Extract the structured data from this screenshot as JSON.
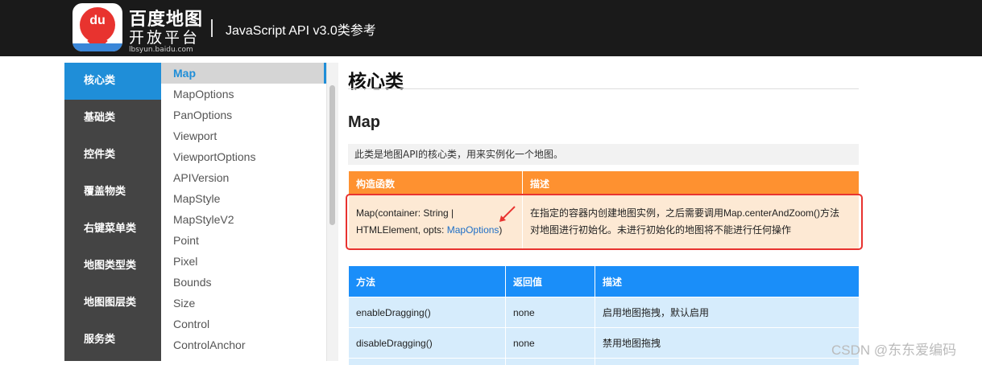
{
  "header": {
    "logo_text": "du",
    "brand_line1": "百度地图",
    "brand_line2": "开放平台",
    "brand_url": "lbsyun.baidu.com",
    "doc_title": "JavaScript API v3.0类参考"
  },
  "categories": [
    "核心类",
    "基础类",
    "控件类",
    "覆盖物类",
    "右键菜单类",
    "地图类型类",
    "地图图层类",
    "服务类"
  ],
  "classes": [
    "Map",
    "MapOptions",
    "PanOptions",
    "Viewport",
    "ViewportOptions",
    "APIVersion",
    "MapStyle",
    "MapStyleV2",
    "Point",
    "Pixel",
    "Bounds",
    "Size",
    "Control",
    "ControlAnchor"
  ],
  "main": {
    "section_title": "核心类",
    "class_title": "Map",
    "class_desc": "此类是地图API的核心类，用来实例化一个地图。",
    "ctor_table": {
      "headers": [
        "构造函数",
        "描述"
      ],
      "sig_part1": "Map(container: String |",
      "sig_part2": "HTMLElement, opts: ",
      "sig_link": "MapOptions",
      "sig_end": ")",
      "desc_line1": "在指定的容器内创建地图实例，之后需要调用Map.centerAndZoom()方法",
      "desc_line2": "对地图进行初始化。未进行初始化的地图将不能进行任何操作"
    },
    "method_table": {
      "headers": [
        "方法",
        "返回值",
        "描述"
      ],
      "rows": [
        [
          "enableDragging()",
          "none",
          "启用地图拖拽，默认启用"
        ],
        [
          "disableDragging()",
          "none",
          "禁用地图拖拽"
        ]
      ]
    }
  },
  "watermark": "CSDN @东东爱编码",
  "colors": {
    "header_bg": "#1a1a1a",
    "nav_bg": "#444444",
    "nav_active": "#1f8ed8",
    "ctor_header": "#fe9130",
    "ctor_row": "#fde9d4",
    "method_header": "#1a8ef9",
    "method_row": "#d6ecfc",
    "highlight": "#e8332f"
  }
}
